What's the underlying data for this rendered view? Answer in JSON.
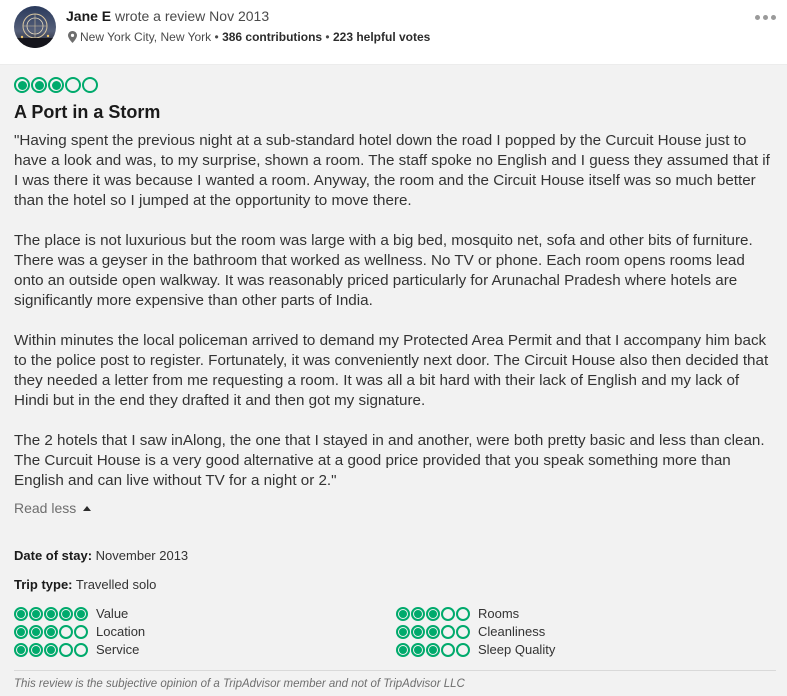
{
  "author": {
    "name": "Jane E",
    "action": "wrote a review Nov 2013",
    "location": "New York City, New York",
    "contributions": "386 contributions",
    "helpful_votes": "223 helpful votes",
    "separator": "•"
  },
  "review": {
    "rating": 3,
    "rating_max": 5,
    "title": "A Port in a Storm",
    "paragraphs": [
      "\"Having spent the previous night at a sub-standard hotel down the road I popped by the Curcuit House just to have a look and was, to my surprise, shown a room. The staff spoke no English and I guess they assumed that if I was there it was because I wanted a room. Anyway, the room and the Circuit House itself was so much better than the hotel so I jumped at the opportunity to move there.",
      "The place is not luxurious but the room was large with a big bed, mosquito net, sofa and other bits of furniture. There was a geyser in the bathroom that worked as wellness. No TV or phone. Each room opens rooms lead onto an outside open walkway. It was reasonably priced particularly for Arunachal Pradesh where hotels are significantly more expensive than other parts of India.",
      "Within minutes the local policeman arrived to demand my Protected Area Permit and that I accompany him back to the police post to register. Fortunately, it was conveniently next door. The Circuit House also then decided that they needed a letter from me requesting a room. It was all a bit hard with their lack of English and my lack of Hindi but in the end they drafted it and then got my signature.",
      "The 2 hotels that I saw inAlong, the one that I stayed in and another, were both pretty basic and less than clean. The Curcuit House is a very good alternative at a good price provided that you speak something more than English and can live without TV for a night or 2.\""
    ],
    "read_less": "Read less",
    "date_of_stay_label": "Date of stay:",
    "date_of_stay": "November 2013",
    "trip_type_label": "Trip type:",
    "trip_type": "Travelled solo",
    "sub_ratings": [
      {
        "label": "Value",
        "rating": 5
      },
      {
        "label": "Location",
        "rating": 3
      },
      {
        "label": "Service",
        "rating": 3
      },
      {
        "label": "Rooms",
        "rating": 3
      },
      {
        "label": "Cleanliness",
        "rating": 3
      },
      {
        "label": "Sleep Quality",
        "rating": 3
      }
    ],
    "disclaimer": "This review is the subjective opinion of a TripAdvisor member and not of TripAdvisor LLC"
  },
  "colors": {
    "bubble": "#00aa6c",
    "body_bg": "#f2f2f2"
  },
  "icons": {
    "location": "map-pin-icon",
    "more": "more-options-icon",
    "collapse": "caret-up-icon"
  }
}
